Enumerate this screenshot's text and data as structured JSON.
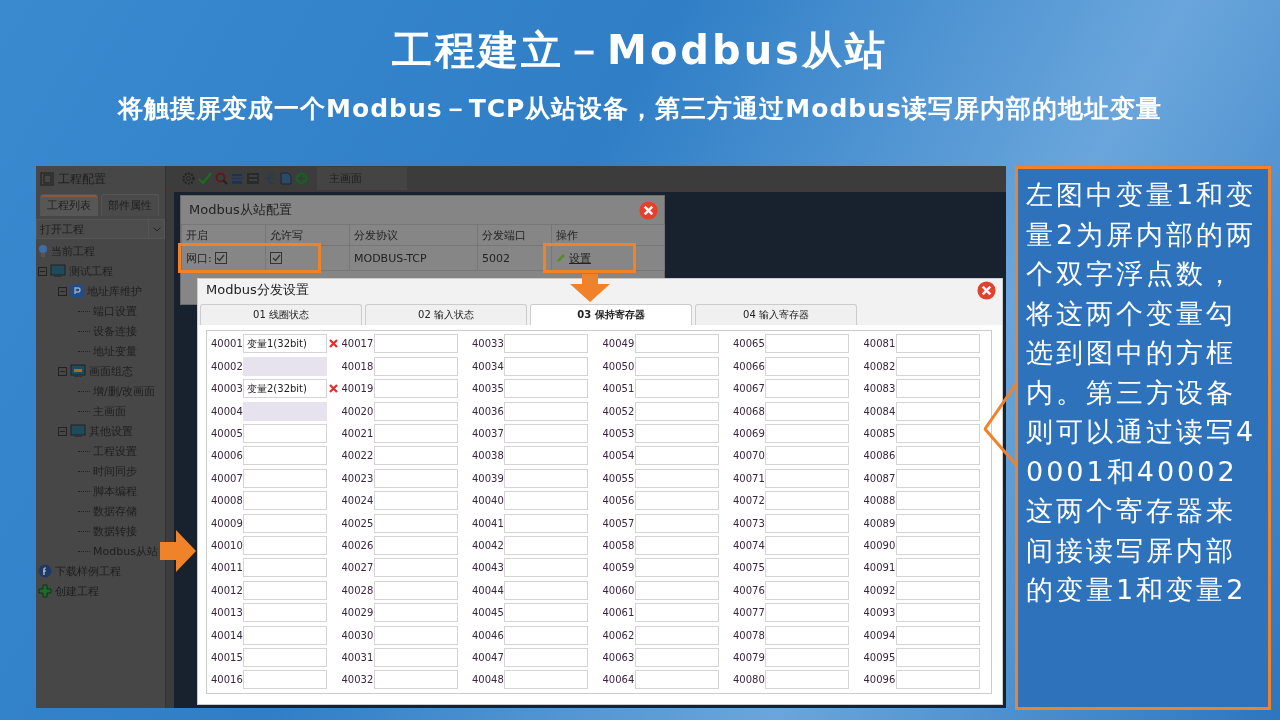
{
  "slide": {
    "title": "工程建立－Modbus从站",
    "subtitle": "将触摸屏变成一个Modbus－TCP从站设备，第三方通过Modbus读写屏内部的地址变量"
  },
  "sidebar": {
    "title": "工程配置",
    "tabs": [
      {
        "label": "工程列表",
        "selected": true
      },
      {
        "label": "部件属性",
        "selected": false
      }
    ],
    "dropdown": {
      "value": "打开工程"
    },
    "tree": [
      {
        "label": "当前工程",
        "kind": "root"
      },
      {
        "label": "测试工程",
        "kind": "project",
        "expanded": true,
        "children": [
          {
            "label": "地址库维护",
            "kind": "library",
            "expanded": true,
            "children": [
              {
                "label": "端口设置",
                "kind": "page"
              },
              {
                "label": "设备连接",
                "kind": "page"
              },
              {
                "label": "地址变量",
                "kind": "page"
              }
            ]
          },
          {
            "label": "画面组态",
            "kind": "screen",
            "expanded": true,
            "children": [
              {
                "label": "增/删/改画面",
                "kind": "page"
              },
              {
                "label": "主画面",
                "kind": "page"
              }
            ]
          },
          {
            "label": "其他设置",
            "kind": "project",
            "expanded": true,
            "children": [
              {
                "label": "工程设置",
                "kind": "page"
              },
              {
                "label": "时间同步",
                "kind": "page"
              },
              {
                "label": "脚本编程",
                "kind": "page"
              },
              {
                "label": "数据存储",
                "kind": "page"
              },
              {
                "label": "数据转接",
                "kind": "page"
              },
              {
                "label": "Modbus从站",
                "kind": "page"
              }
            ]
          }
        ]
      },
      {
        "label": "下载样例工程",
        "kind": "download"
      },
      {
        "label": "创建工程",
        "kind": "create"
      }
    ]
  },
  "toolbar": {
    "tab": "主画面"
  },
  "config_dialog": {
    "title": "Modbus从站配置",
    "columns": [
      "开启",
      "允许写",
      "分发协议",
      "分发端口",
      "操作"
    ],
    "row": {
      "port_label": "网口:",
      "enabled": true,
      "writable": true,
      "protocol": "MODBUS-TCP",
      "port": "5002",
      "action": "设置"
    }
  },
  "dist_dialog": {
    "title": "Modbus分发设置",
    "tabs": [
      {
        "label": "01 线圈状态",
        "selected": false
      },
      {
        "label": "02 输入状态",
        "selected": false
      },
      {
        "label": "03 保持寄存器",
        "selected": true
      },
      {
        "label": "04 输入寄存器",
        "selected": false
      }
    ],
    "registers": [
      {
        "address": "40001",
        "value": "变量1(32bit)",
        "disabled": false
      },
      {
        "address": "40002",
        "disabled": true
      },
      {
        "address": "40003",
        "value": "变量2(32bit)",
        "disabled": false
      },
      {
        "address": "40004",
        "disabled": true
      },
      {
        "address": "40005",
        "disabled": false
      },
      {
        "address": "40006",
        "disabled": false
      },
      {
        "address": "40007",
        "disabled": false
      },
      {
        "address": "40008",
        "disabled": false
      },
      {
        "address": "40009",
        "disabled": false
      },
      {
        "address": "40010",
        "disabled": false
      },
      {
        "address": "40011",
        "disabled": false
      },
      {
        "address": "40012",
        "disabled": false
      },
      {
        "address": "40013",
        "disabled": false
      },
      {
        "address": "40014",
        "disabled": false
      },
      {
        "address": "40015",
        "disabled": false
      },
      {
        "address": "40016",
        "disabled": false
      },
      {
        "address": "40017",
        "disabled": false
      },
      {
        "address": "40018",
        "disabled": false
      },
      {
        "address": "40019",
        "disabled": false
      },
      {
        "address": "40020",
        "disabled": false
      },
      {
        "address": "40021",
        "disabled": false
      },
      {
        "address": "40022",
        "disabled": false
      },
      {
        "address": "40023",
        "disabled": false
      },
      {
        "address": "40024",
        "disabled": false
      },
      {
        "address": "40025",
        "disabled": false
      },
      {
        "address": "40026",
        "disabled": false
      },
      {
        "address": "40027",
        "disabled": false
      },
      {
        "address": "40028",
        "disabled": false
      },
      {
        "address": "40029",
        "disabled": false
      },
      {
        "address": "40030",
        "disabled": false
      },
      {
        "address": "40031",
        "disabled": false
      },
      {
        "address": "40032",
        "disabled": false
      },
      {
        "address": "40033",
        "disabled": false
      },
      {
        "address": "40034",
        "disabled": false
      },
      {
        "address": "40035",
        "disabled": false
      },
      {
        "address": "40036",
        "disabled": false
      },
      {
        "address": "40037",
        "disabled": false
      },
      {
        "address": "40038",
        "disabled": false
      },
      {
        "address": "40039",
        "disabled": false
      },
      {
        "address": "40040",
        "disabled": false
      },
      {
        "address": "40041",
        "disabled": false
      },
      {
        "address": "40042",
        "disabled": false
      },
      {
        "address": "40043",
        "disabled": false
      },
      {
        "address": "40044",
        "disabled": false
      },
      {
        "address": "40045",
        "disabled": false
      },
      {
        "address": "40046",
        "disabled": false
      },
      {
        "address": "40047",
        "disabled": false
      },
      {
        "address": "40048",
        "disabled": false
      },
      {
        "address": "40049",
        "disabled": false
      },
      {
        "address": "40050",
        "disabled": false
      },
      {
        "address": "40051",
        "disabled": false
      },
      {
        "address": "40052",
        "disabled": false
      },
      {
        "address": "40053",
        "disabled": false
      },
      {
        "address": "40054",
        "disabled": false
      },
      {
        "address": "40055",
        "disabled": false
      },
      {
        "address": "40056",
        "disabled": false
      },
      {
        "address": "40057",
        "disabled": false
      },
      {
        "address": "40058",
        "disabled": false
      },
      {
        "address": "40059",
        "disabled": false
      },
      {
        "address": "40060",
        "disabled": false
      },
      {
        "address": "40061",
        "disabled": false
      },
      {
        "address": "40062",
        "disabled": false
      },
      {
        "address": "40063",
        "disabled": false
      },
      {
        "address": "40064",
        "disabled": false
      },
      {
        "address": "40065",
        "disabled": false
      },
      {
        "address": "40066",
        "disabled": false
      },
      {
        "address": "40067",
        "disabled": false
      },
      {
        "address": "40068",
        "disabled": false
      },
      {
        "address": "40069",
        "disabled": false
      },
      {
        "address": "40070",
        "disabled": false
      },
      {
        "address": "40071",
        "disabled": false
      },
      {
        "address": "40072",
        "disabled": false
      },
      {
        "address": "40073",
        "disabled": false
      },
      {
        "address": "40074",
        "disabled": false
      },
      {
        "address": "40075",
        "disabled": false
      },
      {
        "address": "40076",
        "disabled": false
      },
      {
        "address": "40077",
        "disabled": false
      },
      {
        "address": "40078",
        "disabled": false
      },
      {
        "address": "40079",
        "disabled": false
      },
      {
        "address": "40080",
        "disabled": false
      },
      {
        "address": "40081",
        "disabled": false
      },
      {
        "address": "40082",
        "disabled": false
      },
      {
        "address": "40083",
        "disabled": false
      },
      {
        "address": "40084",
        "disabled": false
      },
      {
        "address": "40085",
        "disabled": false
      },
      {
        "address": "40086",
        "disabled": false
      },
      {
        "address": "40087",
        "disabled": false
      },
      {
        "address": "40088",
        "disabled": false
      },
      {
        "address": "40089",
        "disabled": false
      },
      {
        "address": "40090",
        "disabled": false
      },
      {
        "address": "40091",
        "disabled": false
      },
      {
        "address": "40092",
        "disabled": false
      },
      {
        "address": "40093",
        "disabled": false
      },
      {
        "address": "40094",
        "disabled": false
      },
      {
        "address": "40095",
        "disabled": false
      },
      {
        "address": "40096",
        "disabled": false
      }
    ]
  },
  "callout": {
    "text": "左图中变量1和变量2为屏内部的两个双字浮点数，将这两个变量勾选到图中的方框内。第三方设备则可以通过读写40001和40002这两个寄存器来间接读写屏内部的变量1和变量2"
  }
}
